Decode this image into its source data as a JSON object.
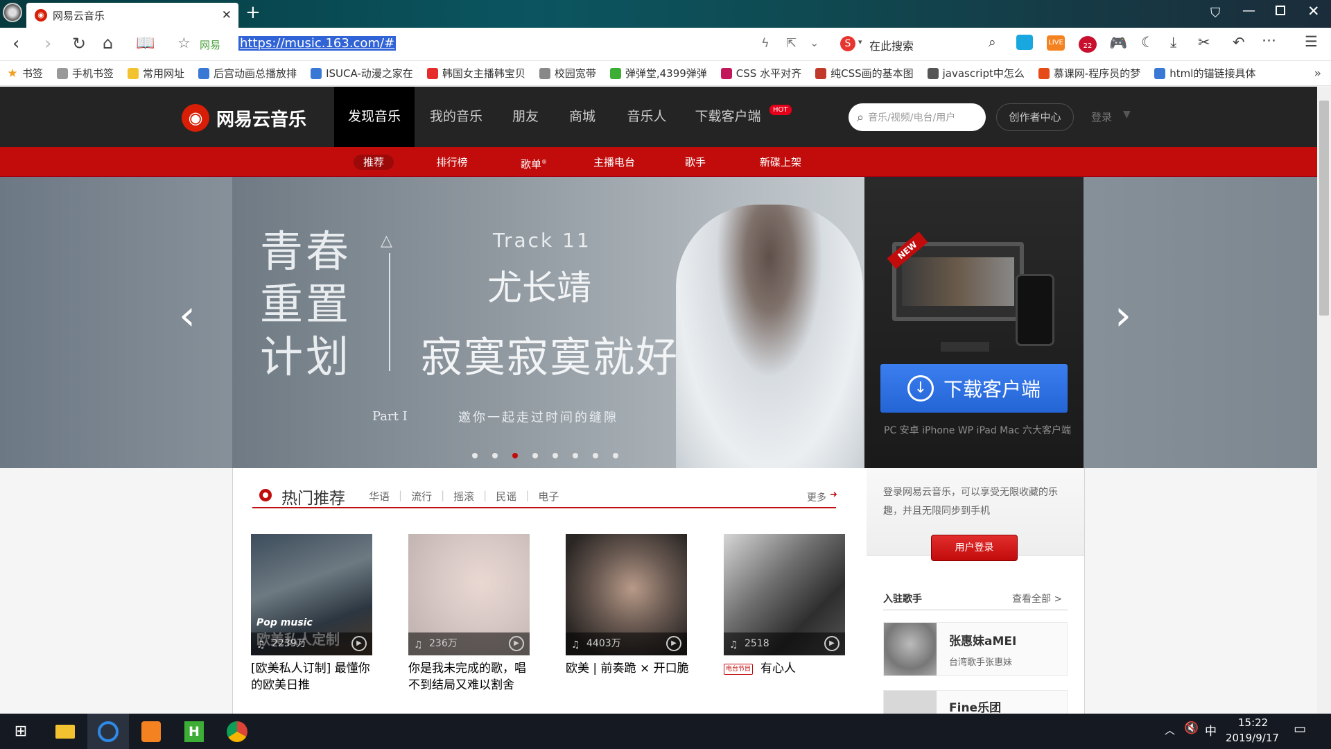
{
  "browser": {
    "tab_title": "网易云音乐",
    "site_label": "网易",
    "url": "https://music.163.com/#",
    "search_placeholder": "在此搜索",
    "live_badge": "LIVE",
    "badge_count": "22"
  },
  "bookmarks": [
    "书签",
    "手机书签",
    "常用网址",
    "后宫动画总播放排",
    "ISUCA-动漫之家在",
    "韩国女主播韩宝贝",
    "校园宽带",
    "弹弹堂,4399弹弹",
    "CSS 水平对齐",
    "纯CSS画的基本图",
    "javascript中怎么",
    "慕课网-程序员的梦",
    "html的锚链接具体"
  ],
  "site": {
    "logo_text": "网易云音乐",
    "nav": [
      "发现音乐",
      "我的音乐",
      "朋友",
      "商城",
      "音乐人",
      "下载客户端"
    ],
    "hot_badge": "HOT",
    "search_placeholder": "音乐/视频/电台/用户",
    "creator_button": "创作者中心",
    "login_link": "登录",
    "subnav": [
      "推荐",
      "排行榜",
      "歌单",
      "主播电台",
      "歌手",
      "新碟上架"
    ],
    "subnav_sup": "®"
  },
  "banner": {
    "big_title_lines": [
      "青春",
      "重置",
      "计划"
    ],
    "track": "Track 11",
    "artist": "尤长靖",
    "song": "寂寞寂寞就好",
    "part": "Part I",
    "slogan": "邀你一起走过时间的缝隙",
    "new_badge": "NEW",
    "download_button": "下载客户端",
    "platforms": "PC 安卓 iPhone WP iPad Mac 六大客户端",
    "dots_count": 8,
    "active_dot": 3
  },
  "hot": {
    "title": "热门推荐",
    "tags": [
      "华语",
      "流行",
      "摇滚",
      "民谣",
      "电子"
    ],
    "more": "更多",
    "items": [
      {
        "count": "2239万",
        "title": "[欧美私人订制] 最懂你的欧美日推",
        "overlay1": "Pop music",
        "overlay2": "欧美私人定制"
      },
      {
        "count": "236万",
        "title": "你是我未完成的歌，唱不到结局又难以割舍"
      },
      {
        "count": "4403万",
        "title": "欧美 | 前奏跪 × 开口脆"
      },
      {
        "count": "2518",
        "title": "有心人",
        "badge": "电台节目"
      }
    ]
  },
  "sidebar": {
    "login_text": "登录网易云音乐，可以享受无限收藏的乐趣，并且无限同步到手机",
    "login_button": "用户登录",
    "singers_title": "入驻歌手",
    "view_all": "查看全部 >",
    "singer_name": "张惠妹aMEI",
    "singer_desc": "台湾歌手张惠妹",
    "singer2_name": "Fine乐团"
  },
  "taskbar": {
    "ime": "中",
    "time": "15:22",
    "date": "2019/9/17"
  }
}
